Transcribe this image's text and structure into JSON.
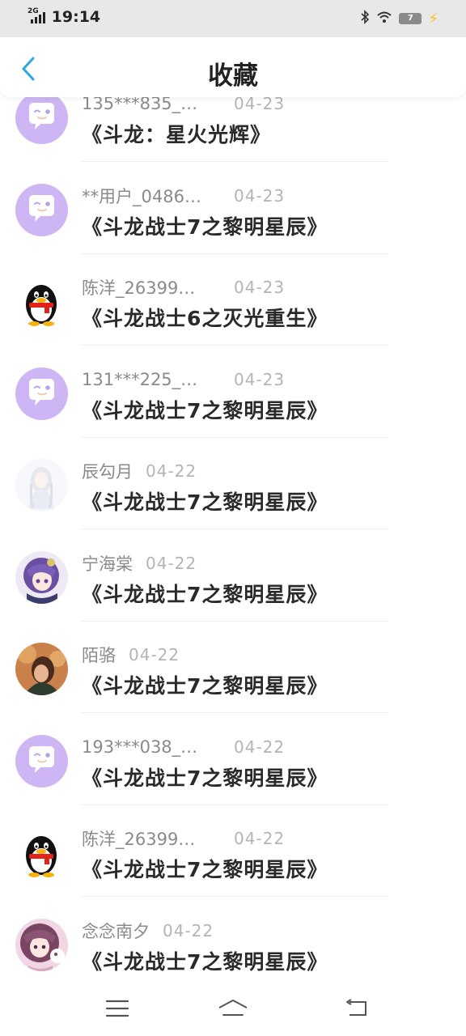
{
  "status_bar": {
    "network": "2G",
    "time": "19:14",
    "battery_level": "7"
  },
  "header": {
    "title": "收藏"
  },
  "list": {
    "items": [
      {
        "user": "135***835_…",
        "date": "04-23",
        "book": "《斗龙：星火光辉》",
        "avatar": "chat-bubble-default-avatar"
      },
      {
        "user": "**用户_0486…",
        "date": "04-23",
        "book": "《斗龙战士7之黎明星辰》",
        "avatar": "chat-bubble-default-avatar"
      },
      {
        "user": "陈洋_26399…",
        "date": "04-23",
        "book": "《斗龙战士6之灭光重生》",
        "avatar": "penguin-avatar"
      },
      {
        "user": "131***225_…",
        "date": "04-23",
        "book": "《斗龙战士7之黎明星辰》",
        "avatar": "chat-bubble-default-avatar"
      },
      {
        "user": "辰勾月",
        "date": "04-22",
        "book": "《斗龙战士7之黎明星辰》",
        "avatar": "white-haired-girl-avatar"
      },
      {
        "user": "宁海棠",
        "date": "04-22",
        "book": "《斗龙战士7之黎明星辰》",
        "avatar": "purple-haired-anime-avatar"
      },
      {
        "user": "陌骆",
        "date": "04-22",
        "book": "《斗龙战士7之黎明星辰》",
        "avatar": "warm-portrait-avatar"
      },
      {
        "user": "193***038_…",
        "date": "04-22",
        "book": "《斗龙战士7之黎明星辰》",
        "avatar": "chat-bubble-default-avatar"
      },
      {
        "user": "陈洋_26399…",
        "date": "04-22",
        "book": "《斗龙战士7之黎明星辰》",
        "avatar": "penguin-avatar"
      },
      {
        "user": "念念南夕",
        "date": "04-22",
        "book": "《斗龙战士7之黎明星辰》",
        "avatar": "pink-haired-anime-avatar"
      }
    ]
  },
  "nav_bar": {
    "buttons": [
      "menu-icon",
      "home-icon",
      "back-icon"
    ]
  },
  "colors": {
    "accent": "#2ea7e0",
    "default_avatar_bg": "#cdb6f3",
    "username": "#8a8a8a",
    "date": "#b4b4b4",
    "title": "#2a2a2a"
  }
}
